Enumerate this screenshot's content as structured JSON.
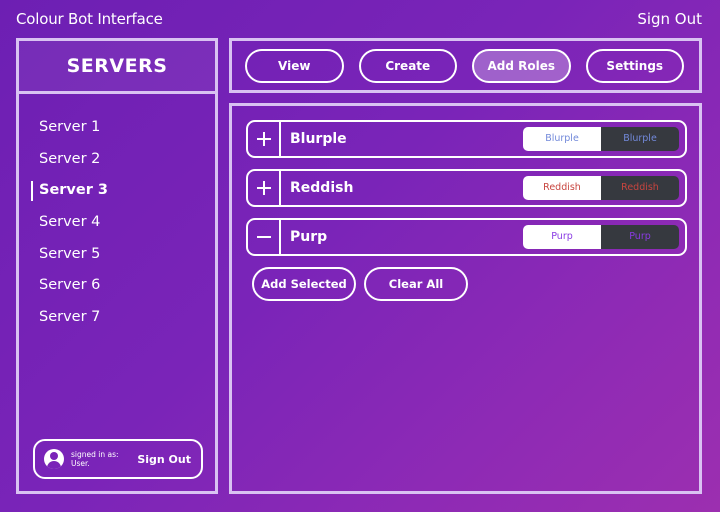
{
  "app": {
    "title": "Colour Bot Interface",
    "sign_out": "Sign Out"
  },
  "sidebar": {
    "title": "SERVERS",
    "servers": [
      "Server 1",
      "Server 2",
      "Server 3",
      "Server 4",
      "Server 5",
      "Server 6",
      "Server 7"
    ],
    "active_server": "Server 3",
    "user": {
      "signed_in_label": "signed in as:",
      "name": "User.",
      "sign_out": "Sign Out"
    }
  },
  "toolbar": {
    "buttons": [
      "View",
      "Create",
      "Add Roles",
      "Settings"
    ],
    "active": "Add Roles"
  },
  "roles": [
    {
      "name": "Blurple",
      "state": "plus",
      "color": "#7289da",
      "preview": "Blurple"
    },
    {
      "name": "Reddish",
      "state": "plus",
      "color": "#c8453f",
      "preview": "Reddish"
    },
    {
      "name": "Purp",
      "state": "minus",
      "color": "#8a3be3",
      "preview": "Purp"
    }
  ],
  "actions": {
    "add_selected": "Add Selected",
    "clear_all": "Clear All"
  },
  "icons": {
    "plus": "plus-icon",
    "minus": "minus-icon",
    "user": "user-circle-icon"
  }
}
